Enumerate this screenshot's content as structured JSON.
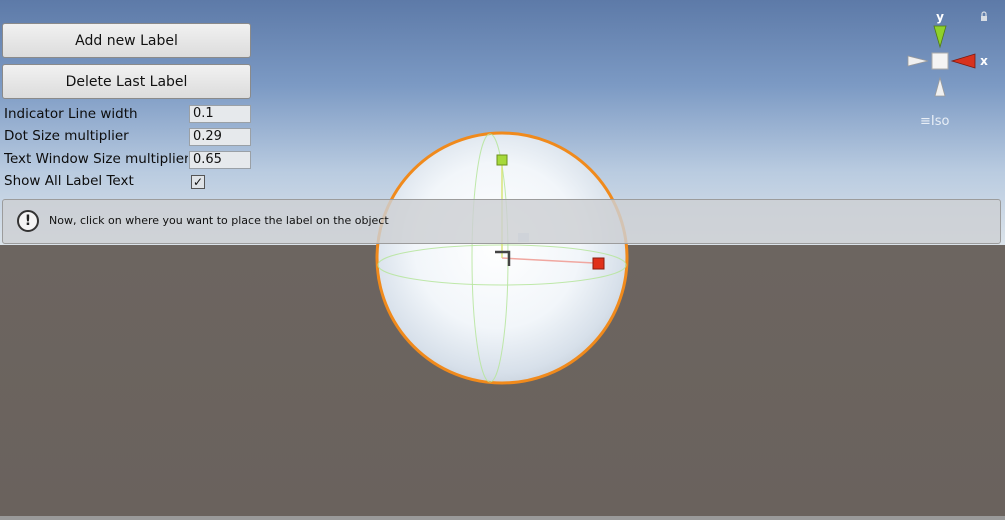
{
  "buttons": {
    "add_label": "Add new Label",
    "delete_label": "Delete Last Label"
  },
  "properties": [
    {
      "label": "Indicator Line width",
      "value": "0.1"
    },
    {
      "label": "Dot Size multiplier",
      "value": "0.29"
    },
    {
      "label": "Text Window Size multiplier",
      "value": "0.65"
    },
    {
      "label": "Show All Label Text",
      "checked": true
    }
  ],
  "help": {
    "icon": "exclamation-icon",
    "message": "Now, click on where you want to place the label on the object"
  },
  "scene_gizmo": {
    "y_axis_label": "y",
    "x_axis_label": "x",
    "projection_label": "Iso",
    "colors": {
      "y": "#8fd12b",
      "x": "#d8321e",
      "neutral": "#f0f0f0"
    }
  },
  "object": {
    "type": "sphere",
    "selection_outline_color": "#f08a1c"
  }
}
